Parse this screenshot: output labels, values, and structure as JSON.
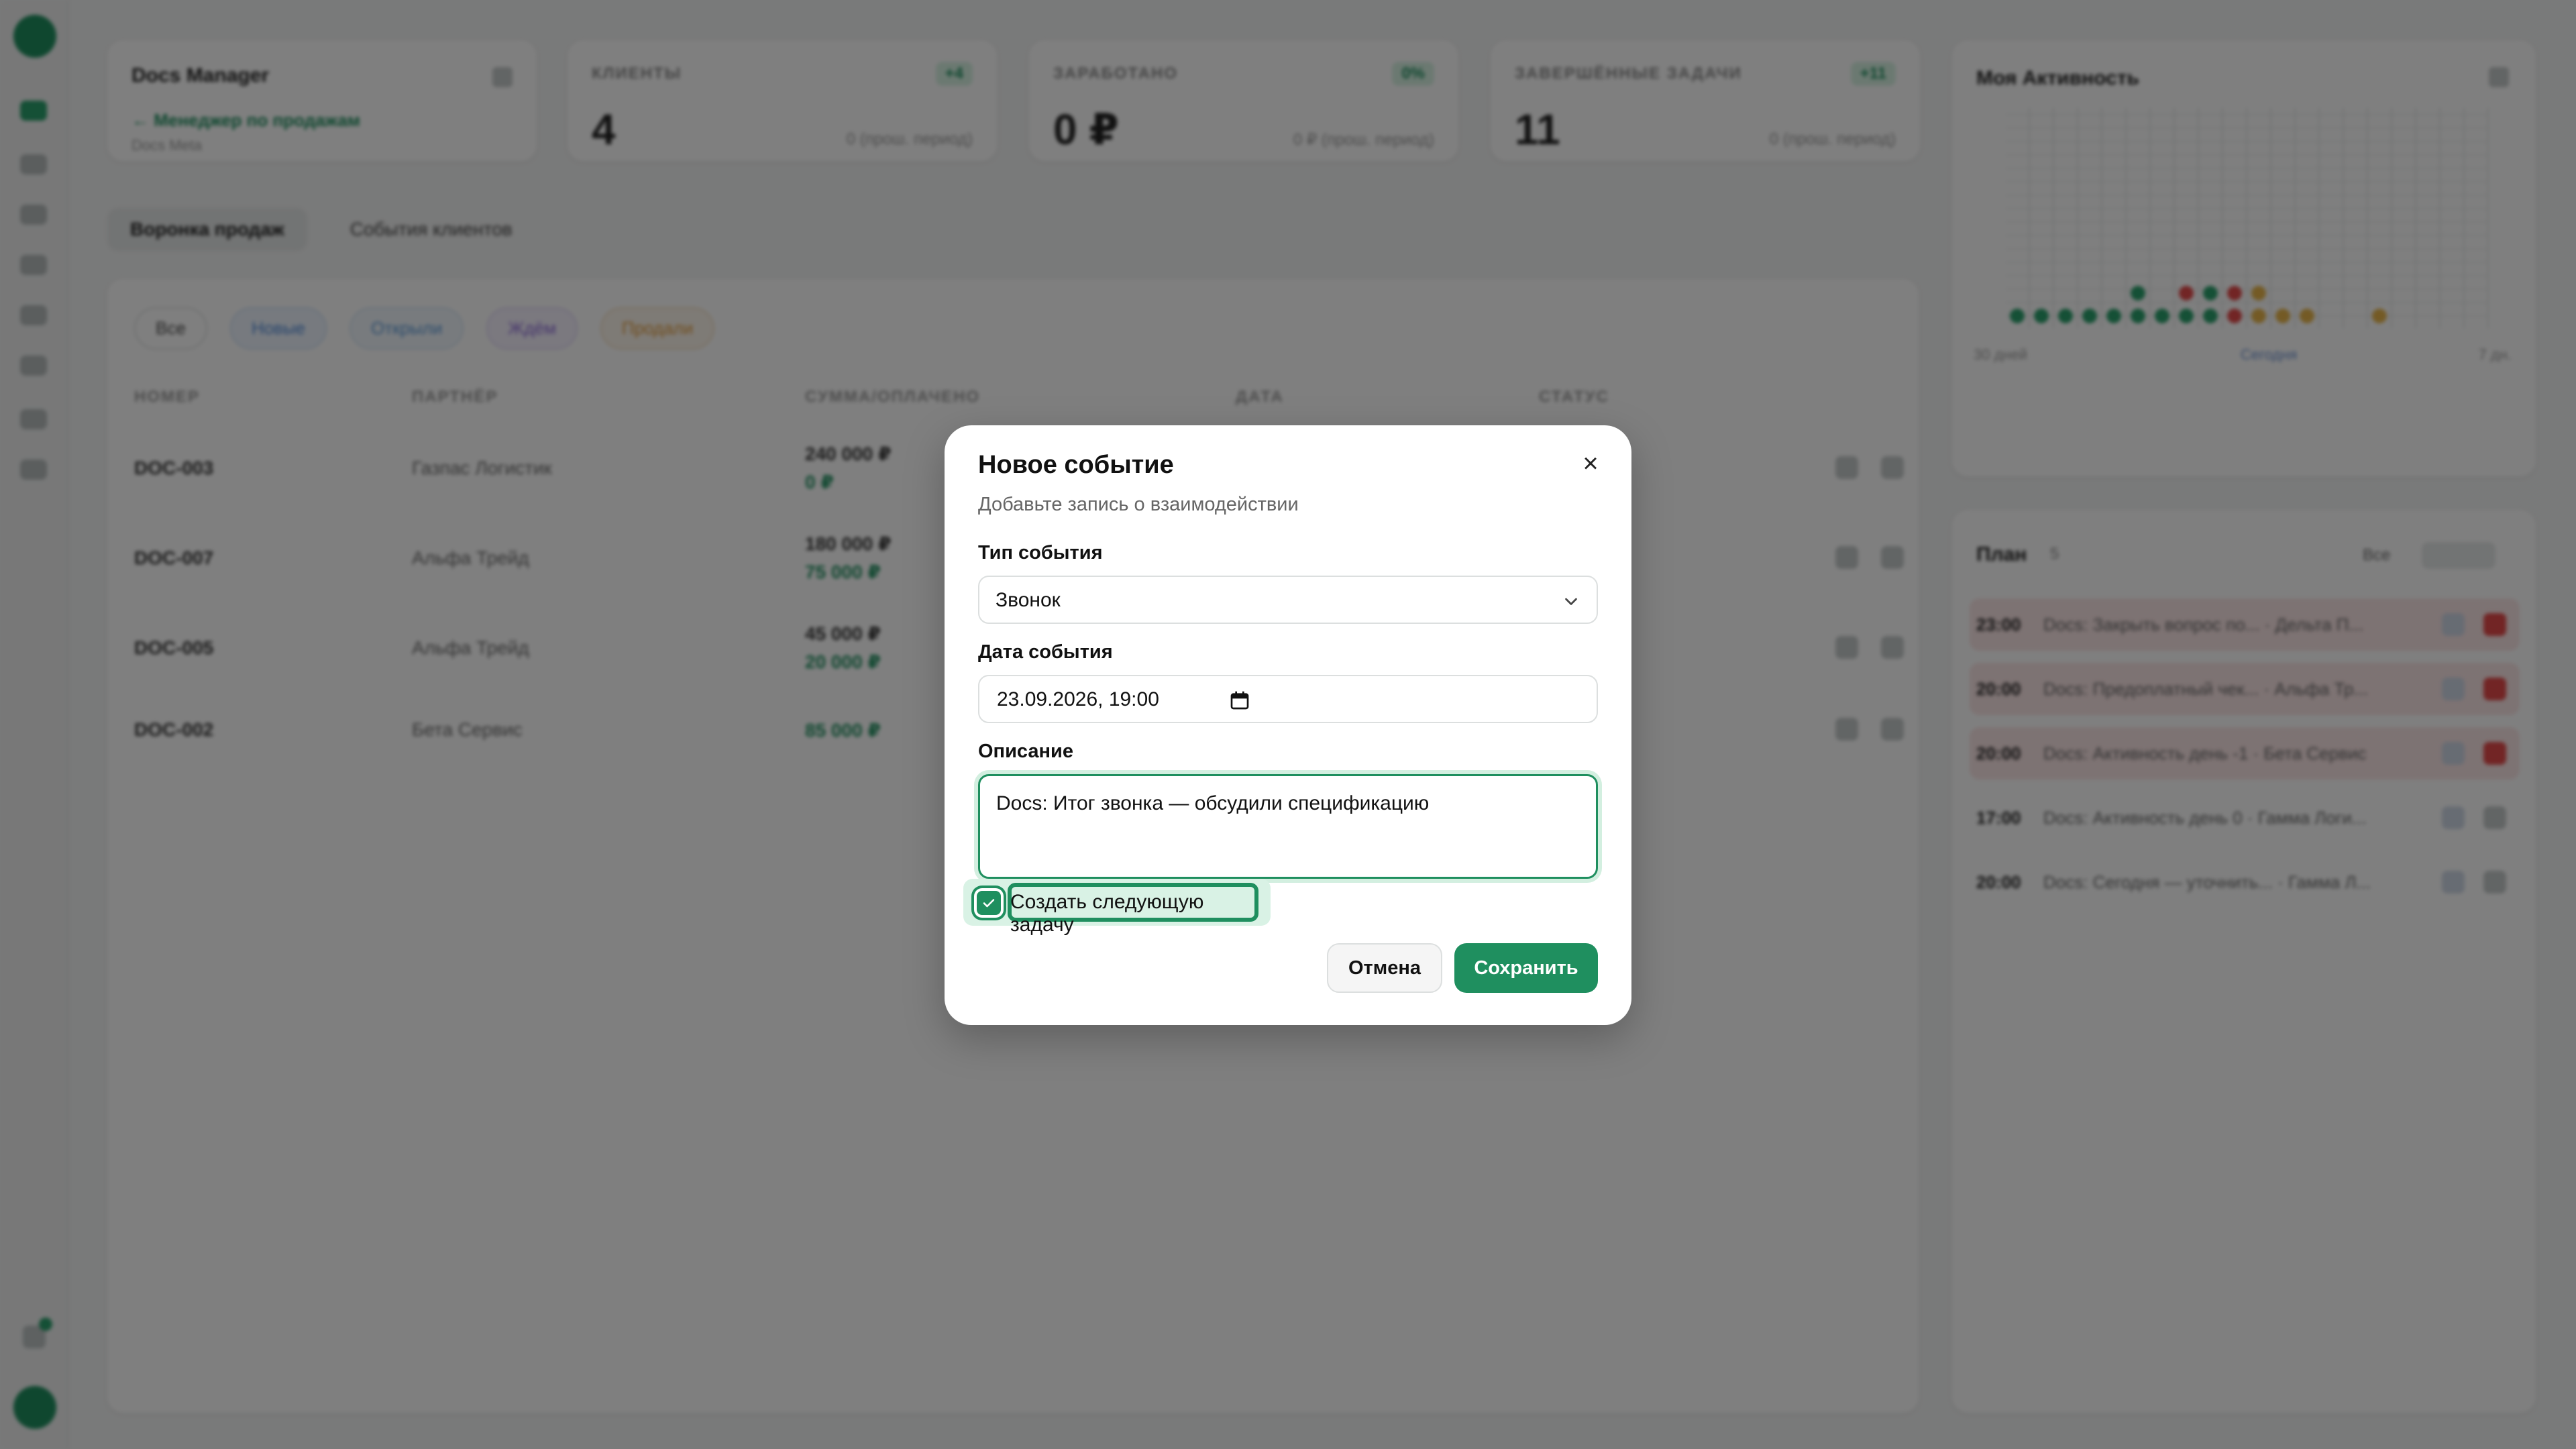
{
  "background": {
    "app_name": "Docs Manager",
    "manager_link": "← Менеджер по продажам",
    "manager_sub": "Docs Meta",
    "kpis": [
      {
        "label": "КЛИЕНТЫ",
        "badge": "+4",
        "value": "4",
        "sub": "0 (прош. период)"
      },
      {
        "label": "ЗАРАБОТАНО",
        "badge": "0%",
        "value": "0 ₽",
        "sub": "0 ₽ (прош. период)"
      },
      {
        "label": "ЗАВЕРШЁННЫЕ ЗАДАЧИ",
        "badge": "+11",
        "value": "11",
        "sub": "0 (прош. период)"
      }
    ],
    "tabs": [
      "Воронка продаж",
      "События клиентов"
    ],
    "filters": [
      "Все",
      "Новые",
      "Открыли",
      "Ждём",
      "Продали"
    ],
    "table_headers": [
      "НОМЕР",
      "ПАРТНЁР",
      "СУММА/ОПЛАЧЕНО",
      "ДАТА",
      "СТАТУС"
    ],
    "rows": [
      {
        "num": "DOC-003",
        "partner": "Газпас Логистик",
        "sum": "240 000 ₽",
        "paid": "0 ₽"
      },
      {
        "num": "DOC-007",
        "partner": "Альфа Трейд",
        "sum": "180 000 ₽",
        "paid": "75 000 ₽"
      },
      {
        "num": "DOC-005",
        "partner": "Альфа Трейд",
        "sum": "45 000 ₽",
        "paid": "20 000 ₽"
      },
      {
        "num": "DOC-002",
        "partner": "Бета Сервис",
        "sum": "85 000 ₽",
        "paid": ""
      }
    ],
    "activity_title": "Моя Активность",
    "activity_axis": [
      "30 дней",
      "Сегодня",
      "7 дн."
    ],
    "plan_title": "План",
    "plan_badge": "5",
    "plan_filter": "Все",
    "plan_items": [
      {
        "time": "23:00",
        "desc": "Docs: Закрыть вопрос по... · Дельта П...",
        "tone": "red"
      },
      {
        "time": "20:00",
        "desc": "Docs: Предоплатный чек... · Альфа Тр...",
        "tone": "red"
      },
      {
        "time": "20:00",
        "desc": "Docs: Активность день -1 · Бета Сервис",
        "tone": "red"
      },
      {
        "time": "17:00",
        "desc": "Docs: Активность день 0 · Гамма Логи...",
        "tone": "plain"
      },
      {
        "time": "20:00",
        "desc": "Docs: Сегодня — уточнить... · Гамма Л...",
        "tone": "plain"
      }
    ]
  },
  "modal": {
    "title": "Новое событие",
    "subtitle": "Добавьте запись о взаимодействии",
    "type_label": "Тип события",
    "type_value": "Звонок",
    "date_label": "Дата события",
    "date_value": "23.09.2026, 19:00",
    "desc_label": "Описание",
    "desc_value": "Docs: Итог звонка — обсудили спецификацию",
    "checkbox_label": "Создать следующую задачу",
    "checkbox_checked": true,
    "cancel_label": "Отмена",
    "save_label": "Сохранить",
    "close_icon": "×"
  },
  "colors": {
    "accent": "#1f8f5f",
    "overlay": "rgba(0,0,0,0.5)",
    "danger": "#e44a4a"
  }
}
